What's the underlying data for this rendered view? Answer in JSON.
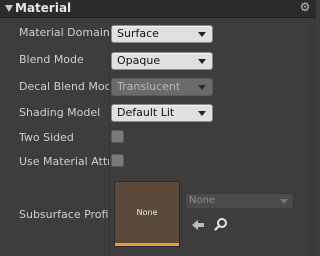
{
  "section": {
    "title": "Material"
  },
  "rows": {
    "material_domain": {
      "label": "Material Domain",
      "value": "Surface"
    },
    "blend_mode": {
      "label": "Blend Mode",
      "value": "Opaque"
    },
    "decal_blend_mode": {
      "label": "Decal Blend Mode",
      "value": "Translucent"
    },
    "shading_model": {
      "label": "Shading Model",
      "value": "Default Lit"
    },
    "two_sided": {
      "label": "Two Sided",
      "checked": false
    },
    "use_material_attributes": {
      "label": "Use Material Attri",
      "checked": false
    },
    "subsurface_profile": {
      "label": "Subsurface Profil",
      "thumbnail_label": "None",
      "asset_value": "None"
    }
  },
  "icons": [
    "expand-arrow-icon",
    "gear-icon",
    "use-selected-arrow-icon",
    "browse-magnifier-icon",
    "dropdown-caret-icon"
  ]
}
